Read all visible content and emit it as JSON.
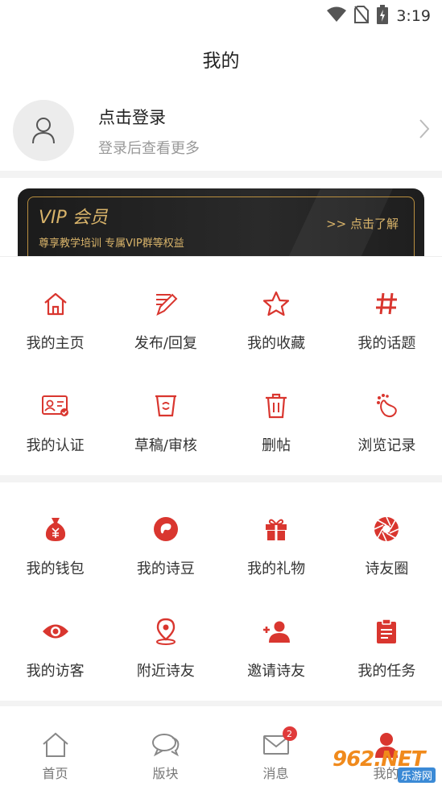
{
  "status_bar": {
    "time": "3:19",
    "icons": [
      "wifi-icon",
      "no-sim-icon",
      "battery-charging-icon"
    ]
  },
  "header": {
    "title": "我的"
  },
  "profile": {
    "title": "点击登录",
    "subtitle": "登录后查看更多"
  },
  "vip": {
    "title": "VIP 会员",
    "subtitle": "尊享教学培训 专属VIP群等权益",
    "link": ">> 点击了解"
  },
  "section1": {
    "items": [
      {
        "label": "我的主页",
        "icon": "home-icon"
      },
      {
        "label": "发布/回复",
        "icon": "edit-icon"
      },
      {
        "label": "我的收藏",
        "icon": "star-icon"
      },
      {
        "label": "我的话题",
        "icon": "hashtag-icon"
      },
      {
        "label": "我的认证",
        "icon": "id-card-icon"
      },
      {
        "label": "草稿/审核",
        "icon": "draft-icon"
      },
      {
        "label": "删帖",
        "icon": "trash-icon"
      },
      {
        "label": "浏览记录",
        "icon": "footprint-icon"
      }
    ]
  },
  "section2": {
    "items": [
      {
        "label": "我的钱包",
        "icon": "money-bag-icon"
      },
      {
        "label": "我的诗豆",
        "icon": "bean-icon"
      },
      {
        "label": "我的礼物",
        "icon": "gift-icon"
      },
      {
        "label": "诗友圈",
        "icon": "shutter-icon"
      },
      {
        "label": "我的访客",
        "icon": "eye-icon"
      },
      {
        "label": "附近诗友",
        "icon": "location-icon"
      },
      {
        "label": "邀请诗友",
        "icon": "add-user-icon"
      },
      {
        "label": "我的任务",
        "icon": "clipboard-icon"
      }
    ]
  },
  "tabbar": {
    "tabs": [
      {
        "label": "首页",
        "icon": "home-outline-icon"
      },
      {
        "label": "版块",
        "icon": "chat-bubbles-icon"
      },
      {
        "label": "消息",
        "icon": "mail-icon",
        "badge": "2"
      },
      {
        "label": "我的",
        "icon": "user-icon"
      }
    ]
  },
  "watermark": {
    "text": "962.NET",
    "subtext": "乐游网"
  },
  "colors": {
    "accent": "#d9362f",
    "gold": "#d9b46a",
    "divider": "#f3f3f3"
  }
}
